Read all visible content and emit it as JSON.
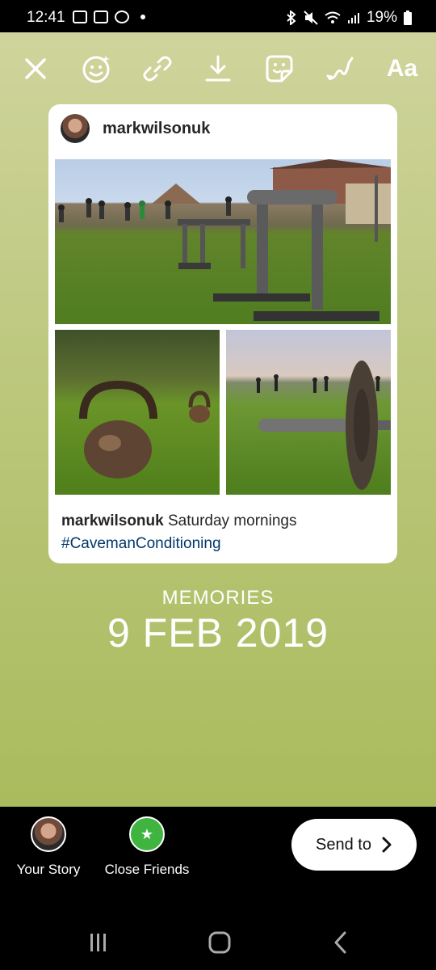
{
  "status_bar": {
    "time": "12:41",
    "battery": "19%"
  },
  "toolbar": {
    "text_label": "Aa",
    "icons": [
      "close-icon",
      "effects-icon",
      "link-icon",
      "download-icon",
      "sticker-icon",
      "draw-icon",
      "text-icon"
    ]
  },
  "post": {
    "username": "markwilsonuk",
    "caption_user": "markwilsonuk",
    "caption_text": "Saturday mornings",
    "hashtag": "#CavemanConditioning"
  },
  "memories": {
    "label": "MEMORIES",
    "date": "9 FEB 2019"
  },
  "share": {
    "your_story": "Your Story",
    "close_friends": "Close Friends",
    "send_to": "Send to"
  },
  "colors": {
    "background_top": "#cfd49c",
    "background_bottom": "#a9bb5d",
    "close_friends_green": "#3fb540",
    "hashtag_blue": "#00376b"
  }
}
